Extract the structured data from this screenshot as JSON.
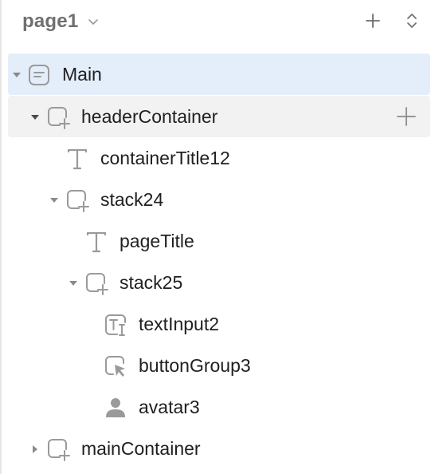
{
  "header": {
    "page_name": "page1",
    "add_icon": "plus-icon",
    "expand_icon": "expand-collapse-icon"
  },
  "tree": [
    {
      "id": "main",
      "label": "Main",
      "icon": "page-icon",
      "expanded": true,
      "selected": true
    },
    {
      "id": "headerContainer",
      "label": "headerContainer",
      "icon": "container-icon",
      "expanded": true,
      "hovered": true
    },
    {
      "id": "containerTitle12",
      "label": "containerTitle12",
      "icon": "text-icon"
    },
    {
      "id": "stack24",
      "label": "stack24",
      "icon": "container-icon",
      "expanded": true
    },
    {
      "id": "pageTitle",
      "label": "pageTitle",
      "icon": "text-icon"
    },
    {
      "id": "stack25",
      "label": "stack25",
      "icon": "container-icon",
      "expanded": true
    },
    {
      "id": "textInput2",
      "label": "textInput2",
      "icon": "text-input-icon"
    },
    {
      "id": "buttonGroup3",
      "label": "buttonGroup3",
      "icon": "cursor-click-icon"
    },
    {
      "id": "avatar3",
      "label": "avatar3",
      "icon": "avatar-icon"
    },
    {
      "id": "mainContainer",
      "label": "mainContainer",
      "icon": "container-icon",
      "expanded": false
    }
  ],
  "colors": {
    "selected_bg": "#e4eefb",
    "hover_bg": "#f2f2f2",
    "icon_gray": "#9a9a9a",
    "text": "#202020"
  }
}
